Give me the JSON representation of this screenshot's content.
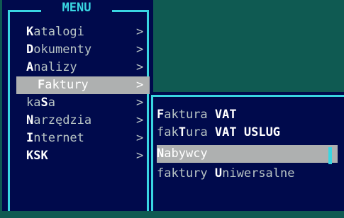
{
  "menu": {
    "title": "MENU",
    "items": [
      {
        "hot": "K",
        "rest": "atalogi",
        "arrow": ">"
      },
      {
        "hot": "D",
        "rest": "okumenty",
        "arrow": ">"
      },
      {
        "hot": "A",
        "rest": "nalizy",
        "arrow": ">"
      },
      {
        "hot": "F",
        "rest": "aktury",
        "arrow": ">"
      },
      {
        "pre": "ka",
        "hot": "S",
        "rest": "a",
        "arrow": ">"
      },
      {
        "hot": "N",
        "rest": "arzędzia",
        "arrow": ">"
      },
      {
        "hot": "I",
        "rest": "nternet",
        "arrow": ">"
      },
      {
        "label": "KSK",
        "arrow": ">"
      }
    ]
  },
  "submenu": {
    "items": [
      {
        "hot": "F",
        "rest": "aktura ",
        "bold_tail": "VAT"
      },
      {
        "pre": "fak",
        "hot": "T",
        "rest": "ura ",
        "bold_tail": "VAT USLUG"
      },
      {
        "hot": "N",
        "rest": "abywcy"
      },
      {
        "pre": "faktury ",
        "hot": "U",
        "rest": "niwersalne"
      }
    ]
  },
  "colors": {
    "background": "#0f5a52",
    "menu_bg": "#000a4c",
    "border": "#39d6e2",
    "selection": "#aeb0b0"
  }
}
